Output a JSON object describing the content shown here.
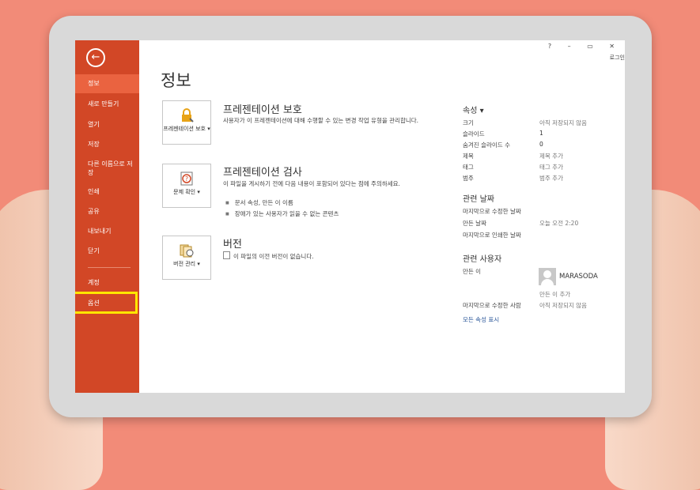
{
  "window": {
    "controls": "? – ▭ ✕",
    "login": "로그인"
  },
  "sidebar": {
    "back_icon": "back-arrow-icon",
    "items": [
      {
        "label": "정보"
      },
      {
        "label": "새로 만들기"
      },
      {
        "label": "열기"
      },
      {
        "label": "저장"
      },
      {
        "label": "다른 이름으로 저장"
      },
      {
        "label": "인쇄"
      },
      {
        "label": "공유"
      },
      {
        "label": "내보내기"
      },
      {
        "label": "닫기"
      },
      {
        "label": "계정"
      },
      {
        "label": "옵션"
      }
    ]
  },
  "main": {
    "title": "정보",
    "sections": [
      {
        "button_label": "프레젠테이션 보호 ▾",
        "title": "프레젠테이션 보호",
        "desc": "사용자가 이 프레젠테이션에 대해 수행할 수 있는 변경 작업 유형을 관리합니다."
      },
      {
        "button_label": "문제 확인 ▾",
        "title": "프레젠테이션 검사",
        "desc": "이 파일을 게시하기 전에 다음 내용이 포함되어 있다는 점에 주의하세요.",
        "bullets": [
          "문서 속성, 만든 이 이름",
          "장애가 있는 사용자가 읽을 수 없는 콘텐츠"
        ]
      },
      {
        "button_label": "버전 관리 ▾",
        "title": "버전",
        "desc": "이 파일의 이전 버전이 없습니다."
      }
    ]
  },
  "properties": {
    "header": "속성 ▾",
    "rows": [
      {
        "k": "크기",
        "v": "아직 저장되지 않음"
      },
      {
        "k": "슬라이드",
        "v": "1"
      },
      {
        "k": "숨겨진 슬라이드 수",
        "v": "0"
      },
      {
        "k": "제목",
        "v": "제목 추가"
      },
      {
        "k": "태그",
        "v": "태그 추가"
      },
      {
        "k": "범주",
        "v": "범주 추가"
      }
    ],
    "dates_header": "관련 날짜",
    "dates": [
      {
        "k": "마지막으로 수정한 날짜",
        "v": ""
      },
      {
        "k": "만든 날짜",
        "v": "오늘 오전 2:20"
      },
      {
        "k": "마지막으로 인쇄한 날짜",
        "v": ""
      }
    ],
    "people_header": "관련 사용자",
    "author_label": "만든 이",
    "author_name": "MARASODA",
    "add_author": "만든 이 추가",
    "last_modified_by_label": "마지막으로 수정한 사람",
    "last_modified_by_value": "아직 저장되지 않음",
    "show_all": "모든 속성 표시"
  }
}
